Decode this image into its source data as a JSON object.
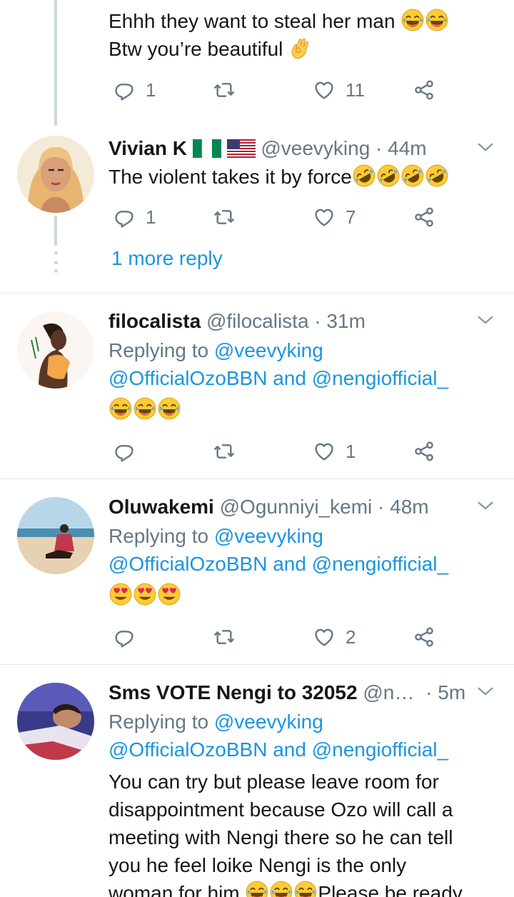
{
  "top_reply": {
    "line1": "Ehhh they want to steal her man",
    "line2": "Btw you’re beautiful",
    "actions": {
      "replies": "1",
      "likes": "11"
    }
  },
  "vivian": {
    "name": "Vivian K",
    "handle": "@veevyking",
    "time": "· 44m",
    "text": "The violent takes it by force",
    "actions": {
      "replies": "1",
      "likes": "7"
    },
    "more_reply": "1 more reply"
  },
  "filo": {
    "name": "filocalista",
    "handle": "@filocalista",
    "time": "· 31m",
    "replying_prefix": "Replying to",
    "reply_to_1": "@veevyking",
    "reply_to_2": "@OfficialOzoBBN",
    "and": "and",
    "reply_to_3": "@nengiofficial_",
    "actions": {
      "replies": "",
      "likes": "1"
    }
  },
  "kemi": {
    "name": "Oluwakemi",
    "handle": "@Ogunniyi_kemi",
    "time": "· 48m",
    "replying_prefix": "Replying to",
    "reply_to_1": "@veevyking",
    "reply_to_2": "@OfficialOzoBBN",
    "and": "and",
    "reply_to_3": "@nengiofficial_",
    "actions": {
      "replies": "",
      "likes": "2"
    }
  },
  "sms": {
    "name": "Sms VOTE Nengi to 32052",
    "handle": "@n…",
    "time": "· 5m",
    "replying_prefix": "Replying to",
    "reply_to_1": "@veevyking",
    "reply_to_2": "@OfficialOzoBBN",
    "and": "and",
    "reply_to_3": "@nengiofficial_",
    "body_1": "You can try but please leave room for",
    "body_2": "disappointment because Ozo will call a",
    "body_3": "meeting with Nengi there so he can tell",
    "body_4": "you he feel loike Nengi is the only",
    "body_5a": "woman for him",
    "body_5b": "Please be ready"
  },
  "colors": {
    "link": "#1b95e0",
    "muted": "#657786",
    "text": "#14171a",
    "line": "#ccd6dd"
  },
  "icons": [
    "reply-icon",
    "retweet-icon",
    "like-icon",
    "share-icon",
    "chevron-down-icon",
    "laughing-emoji",
    "rofl-emoji",
    "ok-hand-emoji",
    "heart-eyes-emoji",
    "flag-nigeria",
    "flag-usa"
  ]
}
